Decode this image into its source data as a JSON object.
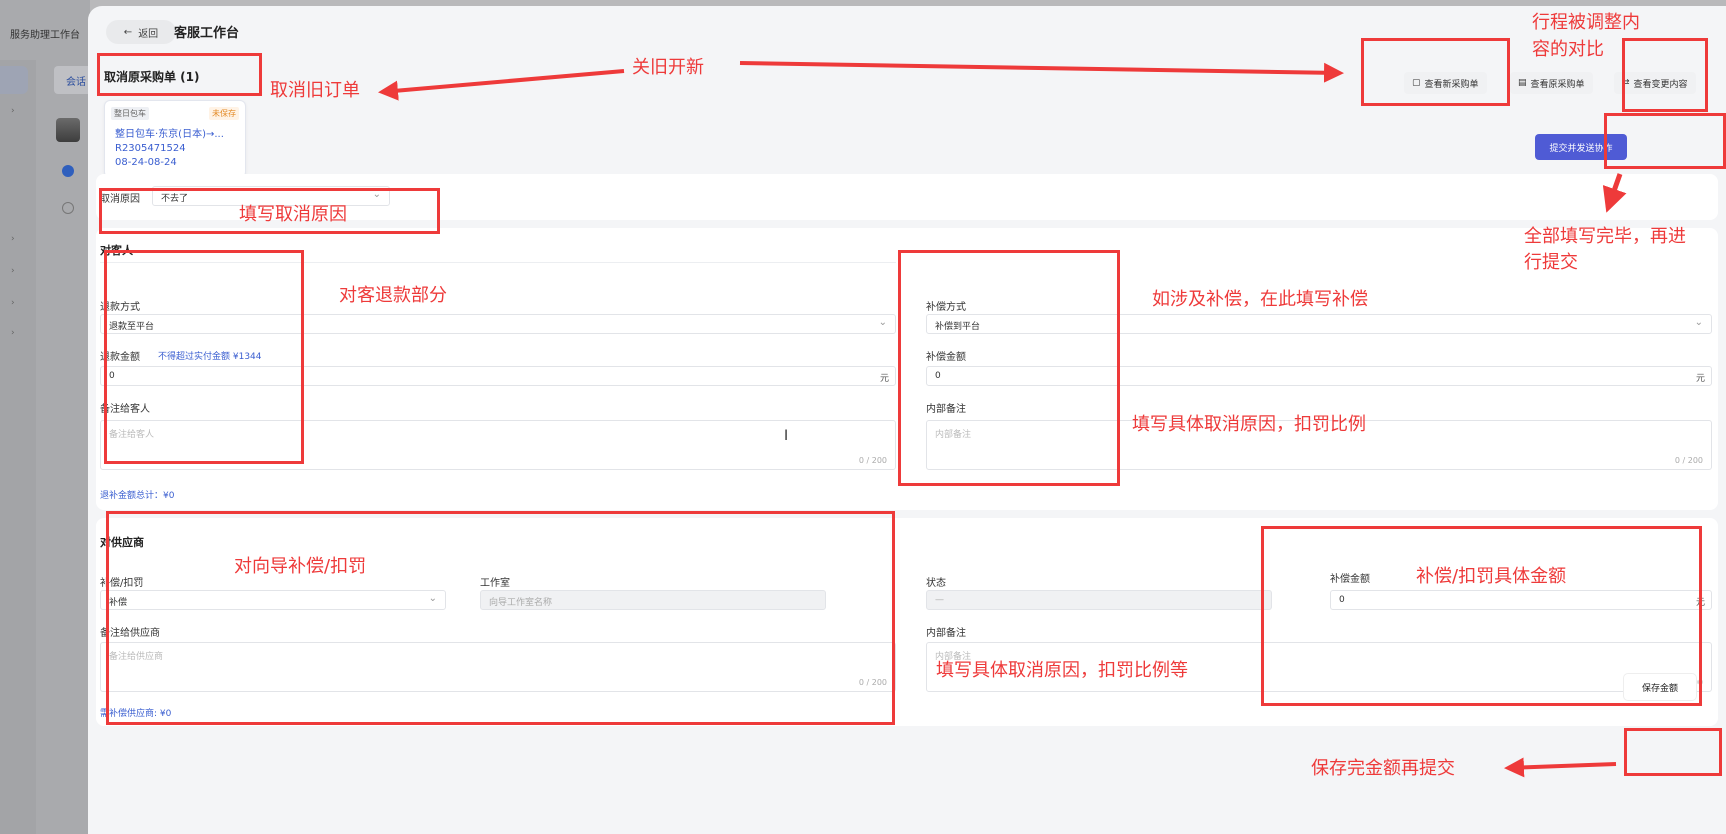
{
  "background_app": {
    "title": "服务助理工作台",
    "tab_label": "会话"
  },
  "header": {
    "back_label": "返回",
    "title": "客服工作台"
  },
  "cancel_section": {
    "title": "取消原采购单 (1)",
    "order_card": {
      "tag": "整日包车",
      "status": "未保存",
      "name": "整日包车·东京(日本)→...",
      "order_no": "R2305471524",
      "dates": "08-24-08-24"
    }
  },
  "toolbar": {
    "view_new": "查看新采购单",
    "view_original": "查看原采购单",
    "view_changes": "查看变更内容",
    "submit": "提交并发送协作"
  },
  "cancel_reason": {
    "label": "取消原因",
    "value": "不去了"
  },
  "customer": {
    "title": "对客人",
    "refund_method_label": "退款方式",
    "refund_method_value": "退款至平台",
    "refund_amount_label": "退款金额",
    "refund_hint": "不得超过实付金额 ¥1344",
    "refund_amount_value": "0",
    "unit": "元",
    "note_label": "备注给客人",
    "note_placeholder": "备注给客人",
    "counter": "0 / 200",
    "comp_method_label": "补偿方式",
    "comp_method_value": "补偿到平台",
    "comp_amount_label": "补偿金额",
    "comp_amount_value": "0",
    "internal_label": "内部备注",
    "internal_placeholder": "内部备注",
    "total": "退补金额总计：¥0"
  },
  "supplier": {
    "title": "对供应商",
    "type_label": "补偿/扣罚",
    "type_value": "补偿",
    "studio_label": "工作室",
    "studio_placeholder": "向导工作室名称",
    "status_label": "状态",
    "status_value": "—",
    "amount_label": "补偿金额",
    "amount_value": "0",
    "unit": "元",
    "note_label": "备注给供应商",
    "note_placeholder": "备注给供应商",
    "internal_label": "内部备注",
    "internal_placeholder": "内部备注",
    "counter": "0 / 200",
    "total": "需补偿供应商: ¥0"
  },
  "save_button": "保存金额",
  "annotations": {
    "close_old_open_new": "关旧开新",
    "cancel_old_order": "取消旧订单",
    "compare_line1": "行程被调整内",
    "compare_line2": "容的对比",
    "fill_reason": "填写取消原因",
    "submit_line1": "全部填写完毕，再进",
    "submit_line2": "行提交",
    "customer_refund": "对客退款部分",
    "compensation": "如涉及补偿，在此填写补偿",
    "specific_reason": "填写具体取消原因，扣罚比例",
    "guide_comp": "对向导补偿/扣罚",
    "specific_amount": "补偿/扣罚具体金额",
    "specific_reason_etc": "填写具体取消原因，扣罚比例等",
    "save_then_submit": "保存完金额再提交",
    "color": "#ee3a3a"
  },
  "icons": [
    "back-arrow-icon",
    "document-icon",
    "chevron-down-icon",
    "chat-icon",
    "cursor-icon"
  ]
}
